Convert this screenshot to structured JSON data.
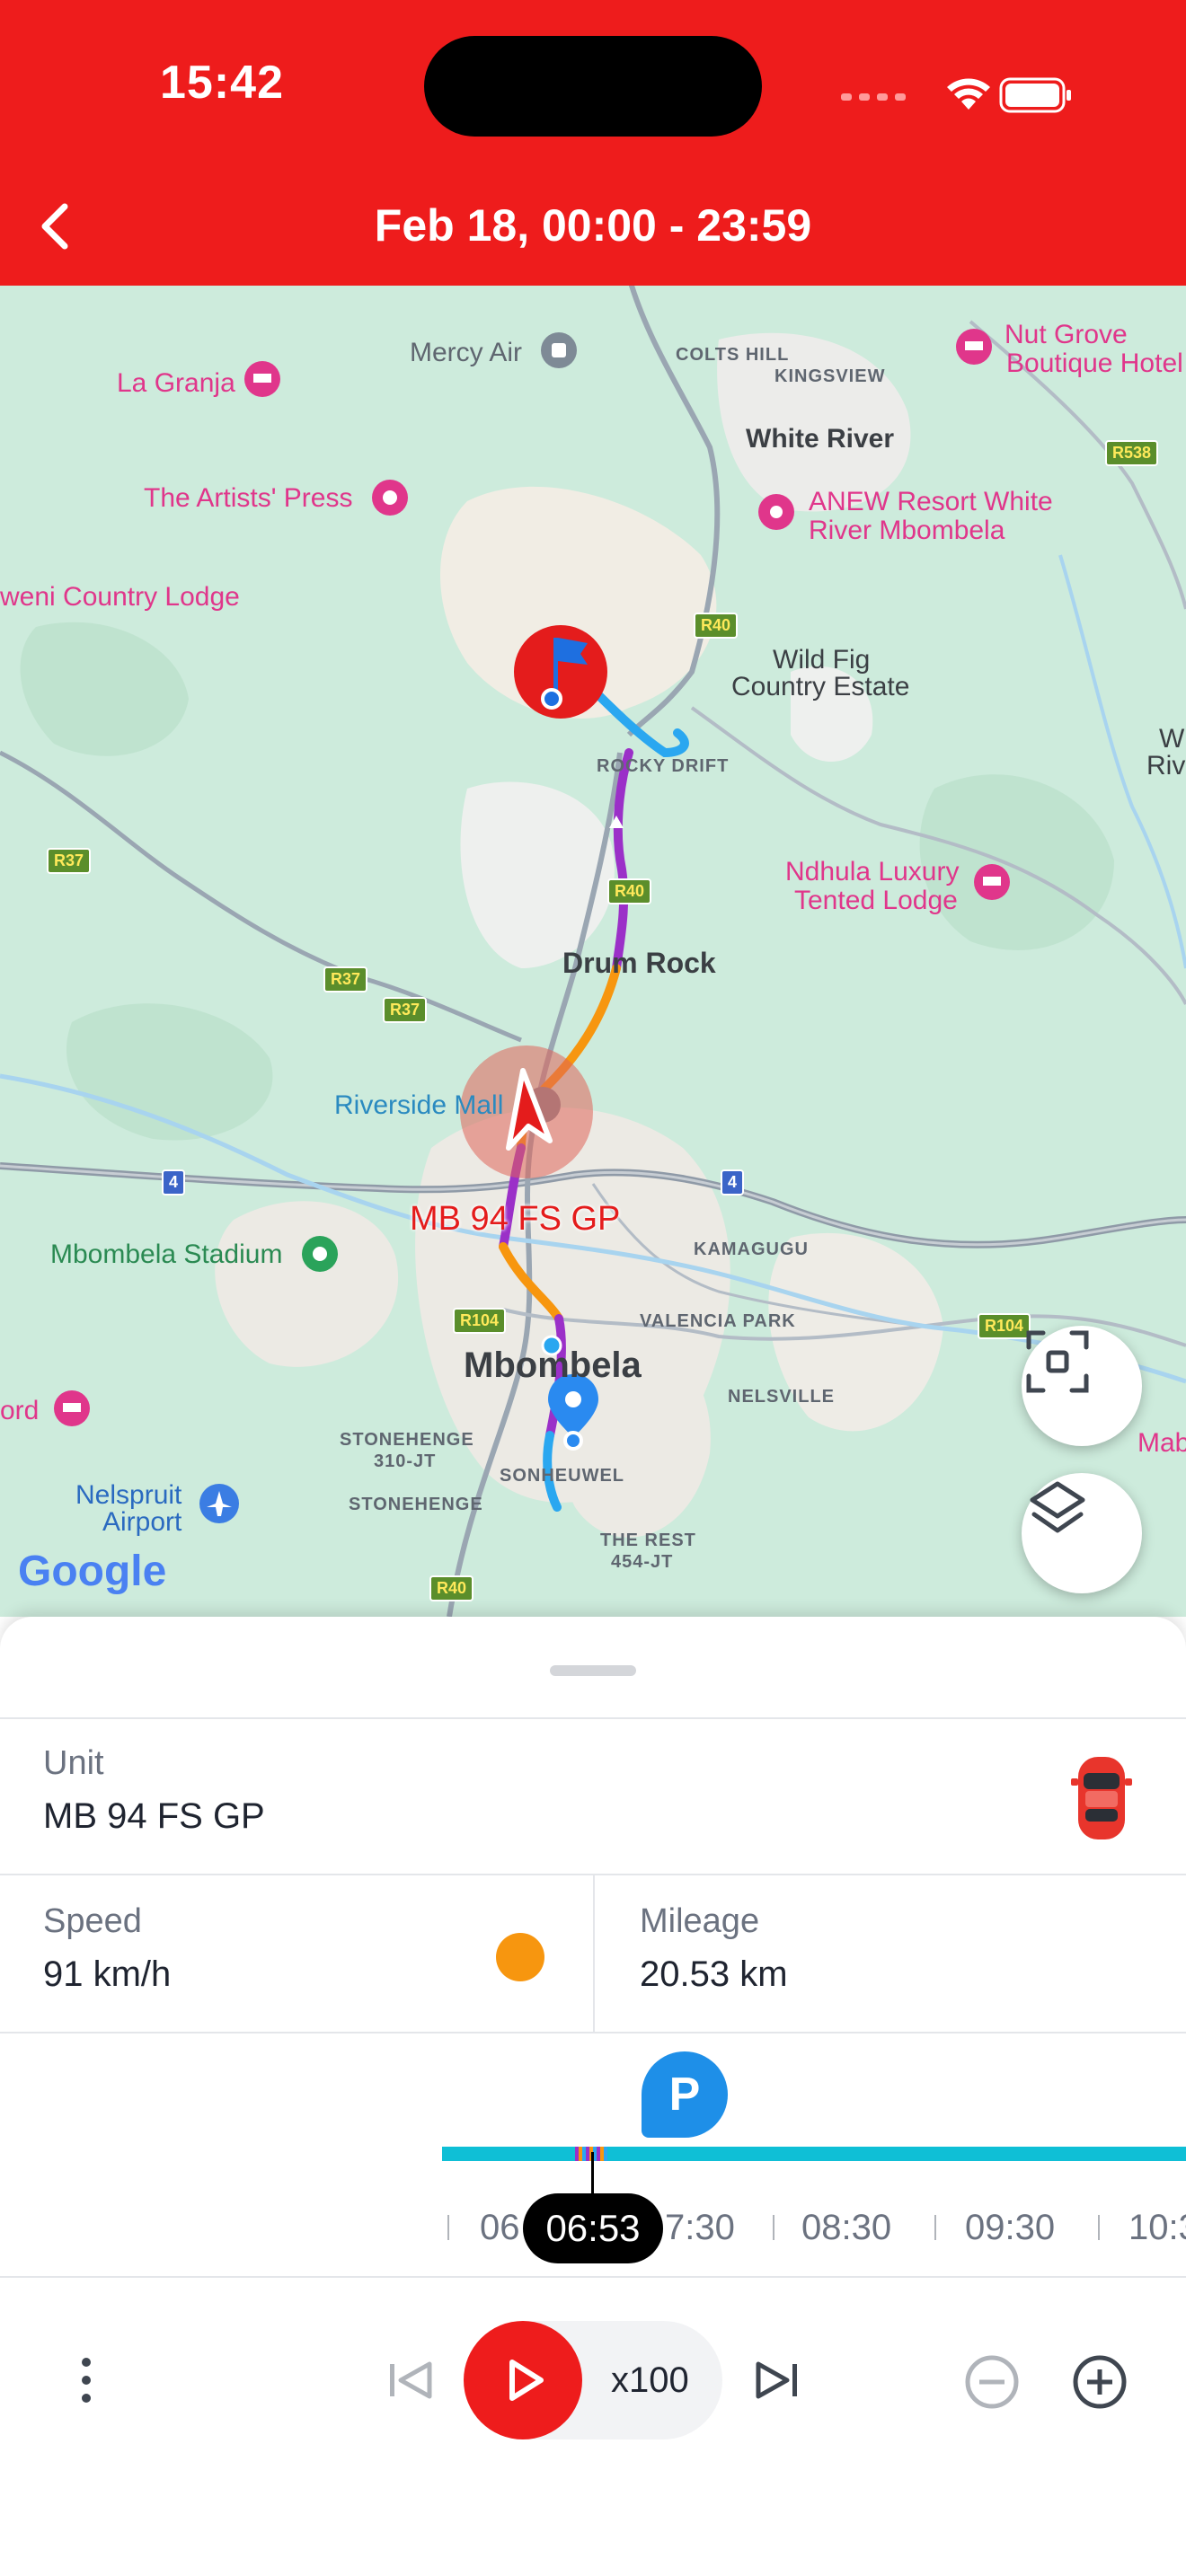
{
  "status_bar": {
    "time": "15:42"
  },
  "header": {
    "title": "Feb 18, 00:00 - 23:59"
  },
  "map": {
    "labels": {
      "mercy_air": "Mercy Air",
      "la_granja": "La Granja",
      "artists_press": "The Artists' Press",
      "country_lodge": "weni Country Lodge",
      "colts_hill": "COLTS HILL",
      "kingsview": "KINGSVIEW",
      "white_river": "White River",
      "anew_resort_1": "ANEW Resort White",
      "anew_resort_2": "River Mbombela",
      "nut_grove_1": "Nut Grove",
      "nut_grove_2": "Boutique Hotel",
      "wild_fig_1": "Wild Fig",
      "wild_fig_2": "Country Estate",
      "rocky_drift": "ROCKY DRIFT",
      "ndhula_1": "Ndhula Luxury",
      "ndhula_2": "Tented Lodge",
      "drum_rock": "Drum Rock",
      "riverside_mall": "Riverside Mall",
      "vehicle_label": "MB 94 FS GP",
      "kamagugu": "KAMAGUGU",
      "mbombela_stadium": "Mbombela Stadium",
      "valencia_park": "VALENCIA PARK",
      "mbombela": "Mbombela",
      "nelsville": "NELSVILLE",
      "ord": "ord",
      "mab": "Mab",
      "stonehenge_310_1": "STONEHENGE",
      "stonehenge_310_2": "310-JT",
      "sonheuwel": "SONHEUWEL",
      "stonehenge": "STONEHENGE",
      "nelspruit_1": "Nelspruit",
      "nelspruit_2": "Airport",
      "rest_1": "THE REST",
      "rest_2": "454-JT",
      "wri_1": "W",
      "wri_2": "Riv",
      "google": "Google"
    },
    "roads": {
      "r40_a": "R40",
      "r40_b": "R40",
      "r40_c": "R40",
      "r37_a": "R37",
      "r37_b": "R37",
      "r37_c": "R37",
      "r538": "R538",
      "r104_a": "R104",
      "r104_b": "R104",
      "n4_a": "4",
      "n4_b": "4"
    }
  },
  "sheet": {
    "unit": {
      "label": "Unit",
      "value": "MB 94 FS GP"
    },
    "speed": {
      "label": "Speed",
      "value": "91 km/h",
      "indicator_color": "#f7960f"
    },
    "mileage": {
      "label": "Mileage",
      "value": "20.53 km"
    }
  },
  "timeline": {
    "ticks": [
      "06",
      "7:30",
      "08:30",
      "09:30",
      "10:3"
    ],
    "current_time": "06:53",
    "parking_marker": "P"
  },
  "controls": {
    "speed": "x100"
  },
  "colors": {
    "brand_red": "#ee1c1c",
    "track": "#0fbfd6",
    "route_purple": "#9b30c8",
    "route_orange": "#f7960f",
    "route_blue": "#2aa7f0"
  }
}
